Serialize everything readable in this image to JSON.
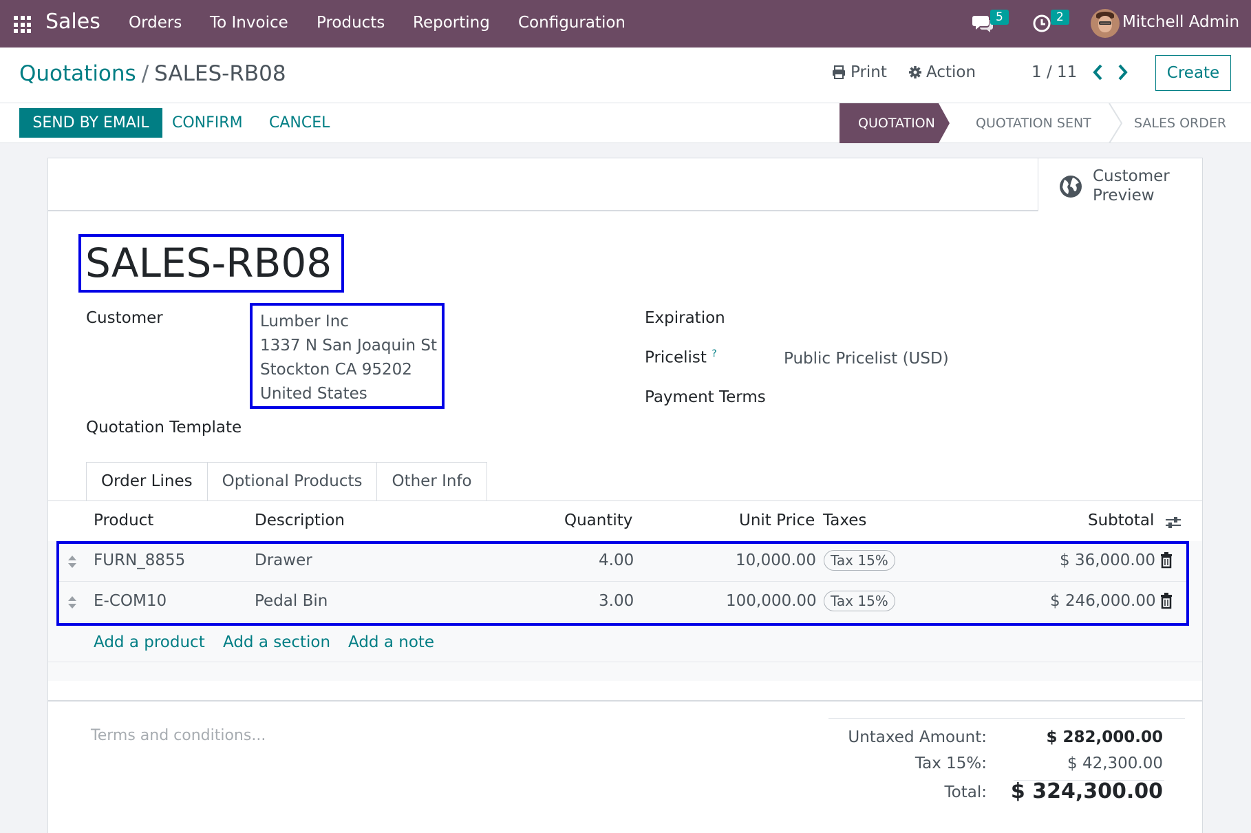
{
  "navbar": {
    "app_name": "Sales",
    "menu": [
      "Orders",
      "To Invoice",
      "Products",
      "Reporting",
      "Configuration"
    ],
    "messages_count": "5",
    "activities_count": "2",
    "user_name": "Mitchell Admin"
  },
  "control": {
    "breadcrumb_parent": "Quotations",
    "breadcrumb_sep": "/",
    "breadcrumb_current": "SALES-RB08",
    "print_label": "Print",
    "action_label": "Action",
    "pager": "1 / 11",
    "create_label": "Create"
  },
  "statusbar": {
    "send_email_label": "SEND BY EMAIL",
    "confirm_label": "CONFIRM",
    "cancel_label": "CANCEL",
    "stages": [
      "QUOTATION",
      "QUOTATION SENT",
      "SALES ORDER"
    ],
    "active_stage": "QUOTATION"
  },
  "sheet": {
    "customer_preview_line1": "Customer",
    "customer_preview_line2": "Preview",
    "name": "SALES-RB08",
    "customer_label": "Customer",
    "customer_address": [
      "Lumber Inc",
      "1337 N San Joaquin St",
      "Stockton CA 95202",
      "United States"
    ],
    "quotation_template_label": "Quotation Template",
    "expiration_label": "Expiration",
    "pricelist_label": "Pricelist",
    "pricelist_help": "?",
    "pricelist_value": "Public Pricelist (USD)",
    "payment_terms_label": "Payment Terms"
  },
  "tabs": [
    "Order Lines",
    "Optional Products",
    "Other Info"
  ],
  "order_lines": {
    "headers": [
      "Product",
      "Description",
      "Quantity",
      "Unit Price",
      "Taxes",
      "Subtotal"
    ],
    "rows": [
      {
        "product": "FURN_8855",
        "description": "Drawer",
        "quantity": "4.00",
        "unit_price": "10,000.00",
        "tax": "Tax 15%",
        "subtotal": "$ 36,000.00"
      },
      {
        "product": "E-COM10",
        "description": "Pedal Bin",
        "quantity": "3.00",
        "unit_price": "100,000.00",
        "tax": "Tax 15%",
        "subtotal": "$ 246,000.00"
      }
    ],
    "add_product": "Add a product",
    "add_section": "Add a section",
    "add_note": "Add a note"
  },
  "footer": {
    "terms_placeholder": "Terms and conditions...",
    "untaxed_label": "Untaxed Amount:",
    "untaxed_value": "$ 282,000.00",
    "tax_label": "Tax 15%:",
    "tax_value": "$ 42,300.00",
    "total_label": "Total:",
    "total_value": "$ 324,300.00"
  },
  "colors": {
    "navbar": "#6b4a63",
    "primary": "#017e84",
    "highlight": "#0000e6"
  }
}
